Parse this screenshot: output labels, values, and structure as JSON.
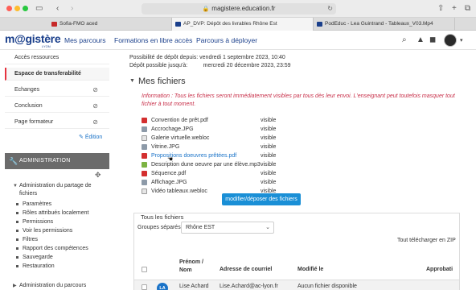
{
  "browser": {
    "url": "magistere.education.fr",
    "tabs": [
      {
        "label": "Sofia-FMO aced",
        "icon_color": "#c62828"
      },
      {
        "label": "AP_DVP: Dépôt des livrables Rhône Est",
        "icon_color": "#1a3f8b"
      },
      {
        "label": "PodEduc - Lea Guintrand - Tableaux_V03.Mp4",
        "icon_color": "#1a3f8b"
      }
    ]
  },
  "header": {
    "logo_main": "m@gistère",
    "logo_sub": "LYON",
    "nav": [
      "Mes parcours",
      "Formations en libre accès",
      "Parcours à déployer"
    ]
  },
  "sidebar": {
    "items": [
      {
        "label": "Accès ressources",
        "hidden_icon": false,
        "active": false
      },
      {
        "label": "Espace de transferabilité",
        "hidden_icon": false,
        "active": true
      },
      {
        "label": "Echanges",
        "hidden_icon": true,
        "active": false
      },
      {
        "label": "Conclusion",
        "hidden_icon": true,
        "active": false
      },
      {
        "label": "Page formateur",
        "hidden_icon": true,
        "active": false
      }
    ],
    "edit_label": "Édition",
    "admin_title": "ADMINISTRATION",
    "admin_tree_title": "Administration du partage de fichiers",
    "admin_items": [
      "Paramètres",
      "Rôles attribués localement",
      "Permissions",
      "Voir les permissions",
      "Filtres",
      "Rapport des compétences",
      "Sauvegarde",
      "Restauration"
    ],
    "admin_tree_next": "Administration du parcours"
  },
  "main": {
    "deposit_open": "Possibilité de dépôt depuis: vendredi 1 septembre 2023, 10:40",
    "deposit_until": "Dépôt possible jusqu'à:          mercredi 20 décembre 2023, 23:59",
    "section_title": "Mes fichiers",
    "info": "Information : Tous les fichiers seront immédiatement visibles par tous dès leur envoi. L'enseignant peut toutefois masquer tout fichier à tout moment.",
    "files": [
      {
        "name": "Convention de prêt.pdf",
        "visibility": "visible",
        "type": "pdf",
        "link": false
      },
      {
        "name": "Accrochage.JPG",
        "visibility": "visible",
        "type": "image",
        "link": false
      },
      {
        "name": "Galerie virtuelle.webloc",
        "visibility": "visible",
        "type": "webloc",
        "link": false
      },
      {
        "name": "Vitrine.JPG",
        "visibility": "visible",
        "type": "image",
        "link": false
      },
      {
        "name": "Propositions doeuvres prêtées.pdf",
        "visibility": "visible",
        "type": "pdf",
        "link": true
      },
      {
        "name": "Description dune oeuvre par une élève.mp3",
        "visibility": "visible",
        "type": "audio",
        "link": false
      },
      {
        "name": "Séquence.pdf",
        "visibility": "visible",
        "type": "pdf",
        "link": false
      },
      {
        "name": "Affichage.JPG",
        "visibility": "visible",
        "type": "image",
        "link": false
      },
      {
        "name": "Vidéo tableaux.webloc",
        "visibility": "visible",
        "type": "webloc",
        "link": false
      }
    ],
    "upload_button": "modifier/déposer des fichiers",
    "all_files": {
      "title": "Tous les fichiers",
      "group_label": "Groupes séparés",
      "group_value": "Rhône EST",
      "download_all": "Tout télécharger en ZIP",
      "columns": [
        "Prénom / Nom",
        "Adresse de courriel",
        "Modifié le",
        "Approbati"
      ],
      "rows": [
        {
          "initials": "LA",
          "name": "Lise Achard",
          "email": "Lise.Achard@ac-lyon.fr",
          "modified": "Aucun fichier disponible"
        }
      ]
    }
  },
  "colors": {
    "brand_blue": "#1a3f8b",
    "accent_red": "#e6323e",
    "link_blue": "#1a73c8",
    "button_blue": "#1a8fd6",
    "info_red": "#c8304a",
    "admin_gray": "#6b6b6b"
  }
}
